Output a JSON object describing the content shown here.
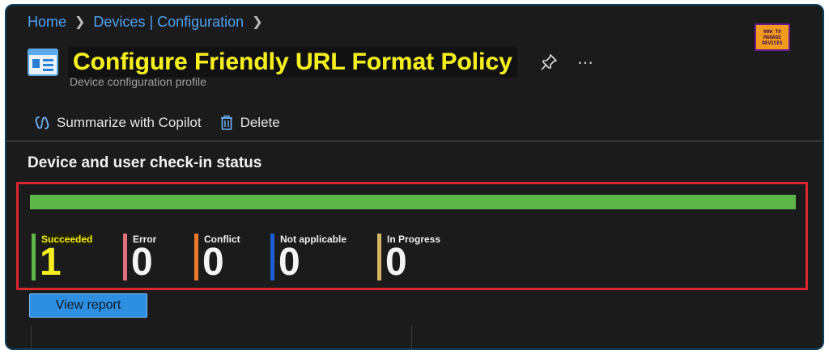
{
  "breadcrumb": {
    "items": [
      "Home",
      "Devices | Configuration"
    ]
  },
  "header": {
    "title": "Configure Friendly URL Format Policy",
    "subtitle": "Device configuration profile"
  },
  "logo": {
    "lines": [
      "HOW TO",
      "MANAGE",
      "DEVICES"
    ]
  },
  "toolbar": {
    "summarize_label": "Summarize with Copilot",
    "delete_label": "Delete"
  },
  "section": {
    "title": "Device and user check-in status"
  },
  "status": {
    "bar_success_fraction": 1.0,
    "items": [
      {
        "label": "Succeeded",
        "value": "1",
        "color": "#5eb54a"
      },
      {
        "label": "Error",
        "value": "0",
        "color": "#e0707a"
      },
      {
        "label": "Conflict",
        "value": "0",
        "color": "#ec7a2a"
      },
      {
        "label": "Not applicable",
        "value": "0",
        "color": "#1f5fd6"
      },
      {
        "label": "In Progress",
        "value": "0",
        "color": "#d6b764"
      }
    ]
  },
  "actions": {
    "view_report_label": "View report"
  },
  "colors": {
    "accent": "#4ea1f3",
    "highlight": "#f5ef1f",
    "outline": "#d8282e"
  }
}
